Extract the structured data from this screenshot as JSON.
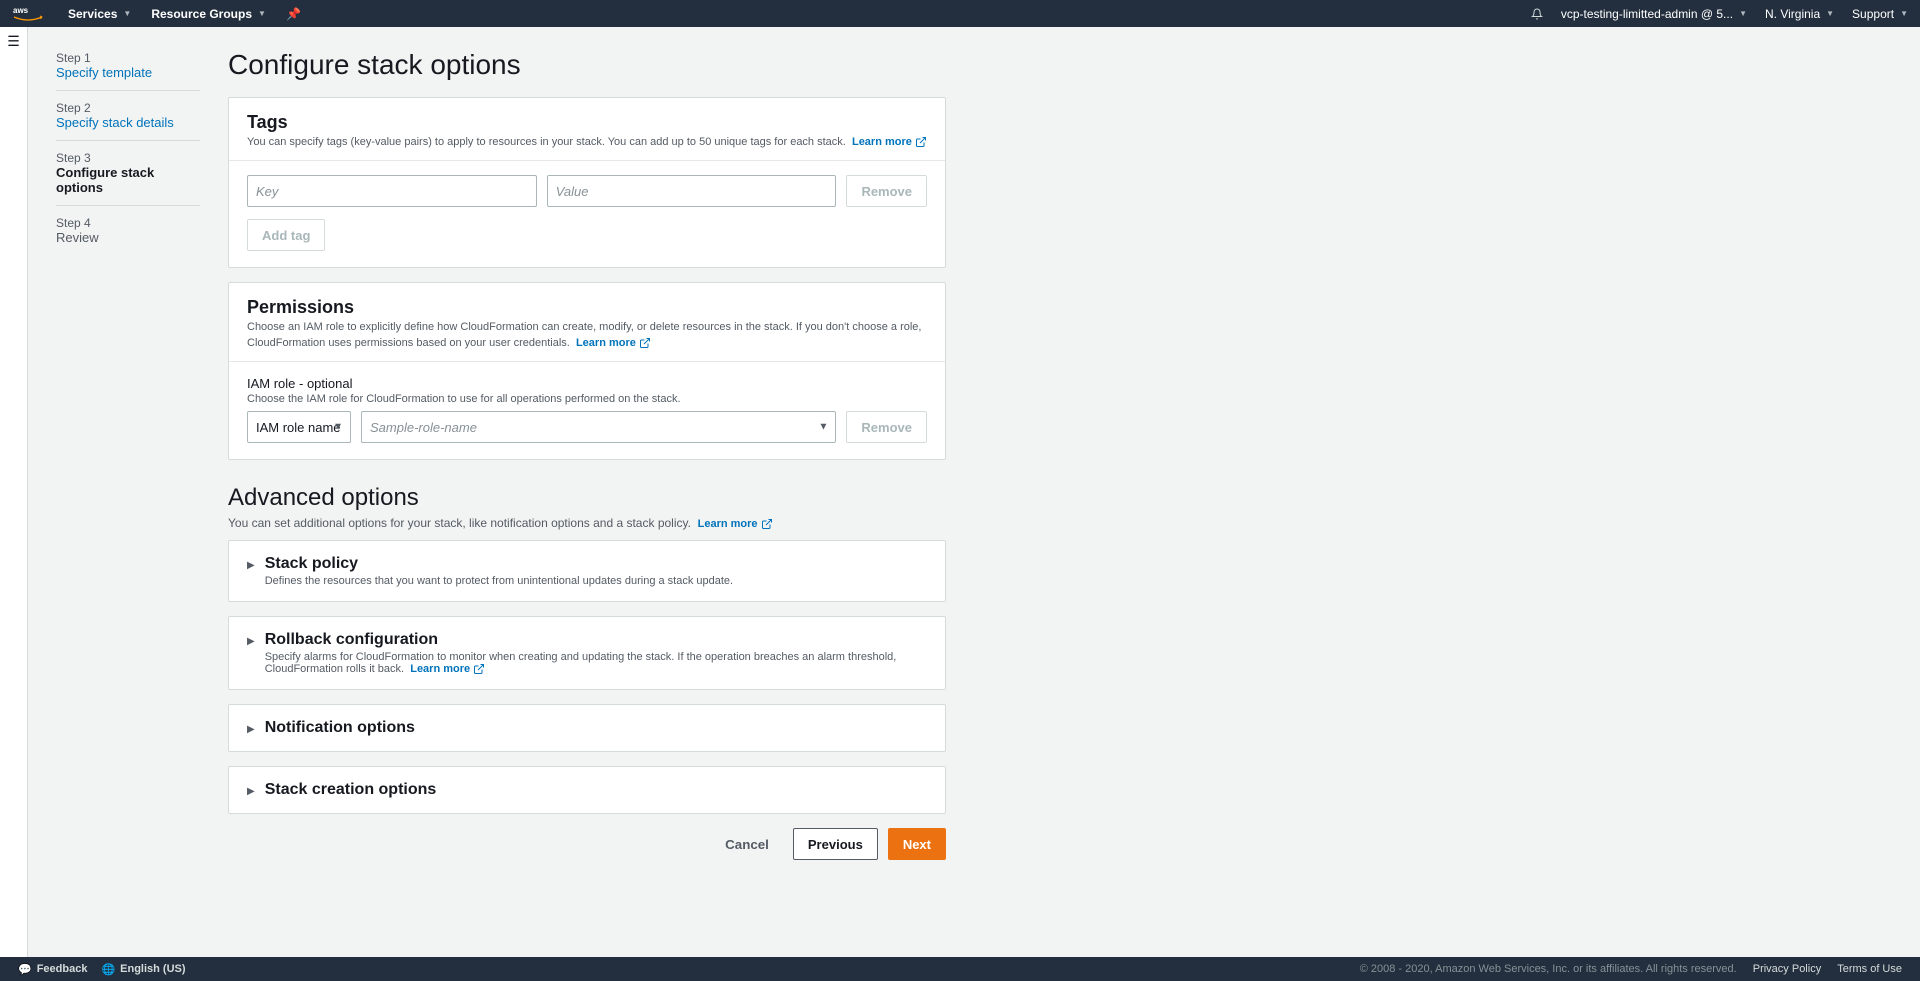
{
  "nav": {
    "services": "Services",
    "resource_groups": "Resource Groups",
    "account": "vcp-testing-limitted-admin @ 5...",
    "region": "N. Virginia",
    "support": "Support"
  },
  "steps": [
    {
      "num": "Step 1",
      "title": "Specify template"
    },
    {
      "num": "Step 2",
      "title": "Specify stack details"
    },
    {
      "num": "Step 3",
      "title": "Configure stack options"
    },
    {
      "num": "Step 4",
      "title": "Review"
    }
  ],
  "page": {
    "title": "Configure stack options"
  },
  "tags": {
    "heading": "Tags",
    "desc": "You can specify tags (key-value pairs) to apply to resources in your stack. You can add up to 50 unique tags for each stack.",
    "learn": "Learn more",
    "key_placeholder": "Key",
    "value_placeholder": "Value",
    "remove": "Remove",
    "add": "Add tag"
  },
  "permissions": {
    "heading": "Permissions",
    "desc": "Choose an IAM role to explicitly define how CloudFormation can create, modify, or delete resources in the stack. If you don't choose a role, CloudFormation uses permissions based on your user credentials.",
    "learn": "Learn more",
    "iam_label": "IAM role - optional",
    "iam_help": "Choose the IAM role for CloudFormation to use for all operations performed on the stack.",
    "select_value": "IAM role name",
    "combo_placeholder": "Sample-role-name",
    "remove": "Remove"
  },
  "advanced": {
    "heading": "Advanced options",
    "desc": "You can set additional options for your stack, like notification options and a stack policy.",
    "learn": "Learn more",
    "stack_policy": {
      "title": "Stack policy",
      "desc": "Defines the resources that you want to protect from unintentional updates during a stack update."
    },
    "rollback": {
      "title": "Rollback configuration",
      "desc": "Specify alarms for CloudFormation to monitor when creating and updating the stack. If the operation breaches an alarm threshold, CloudFormation rolls it back.",
      "learn": "Learn more"
    },
    "notification": {
      "title": "Notification options"
    },
    "creation": {
      "title": "Stack creation options"
    }
  },
  "wizard_buttons": {
    "cancel": "Cancel",
    "previous": "Previous",
    "next": "Next"
  },
  "footer": {
    "feedback": "Feedback",
    "language": "English (US)",
    "copyright": "© 2008 - 2020, Amazon Web Services, Inc. or its affiliates. All rights reserved.",
    "privacy": "Privacy Policy",
    "terms": "Terms of Use"
  }
}
